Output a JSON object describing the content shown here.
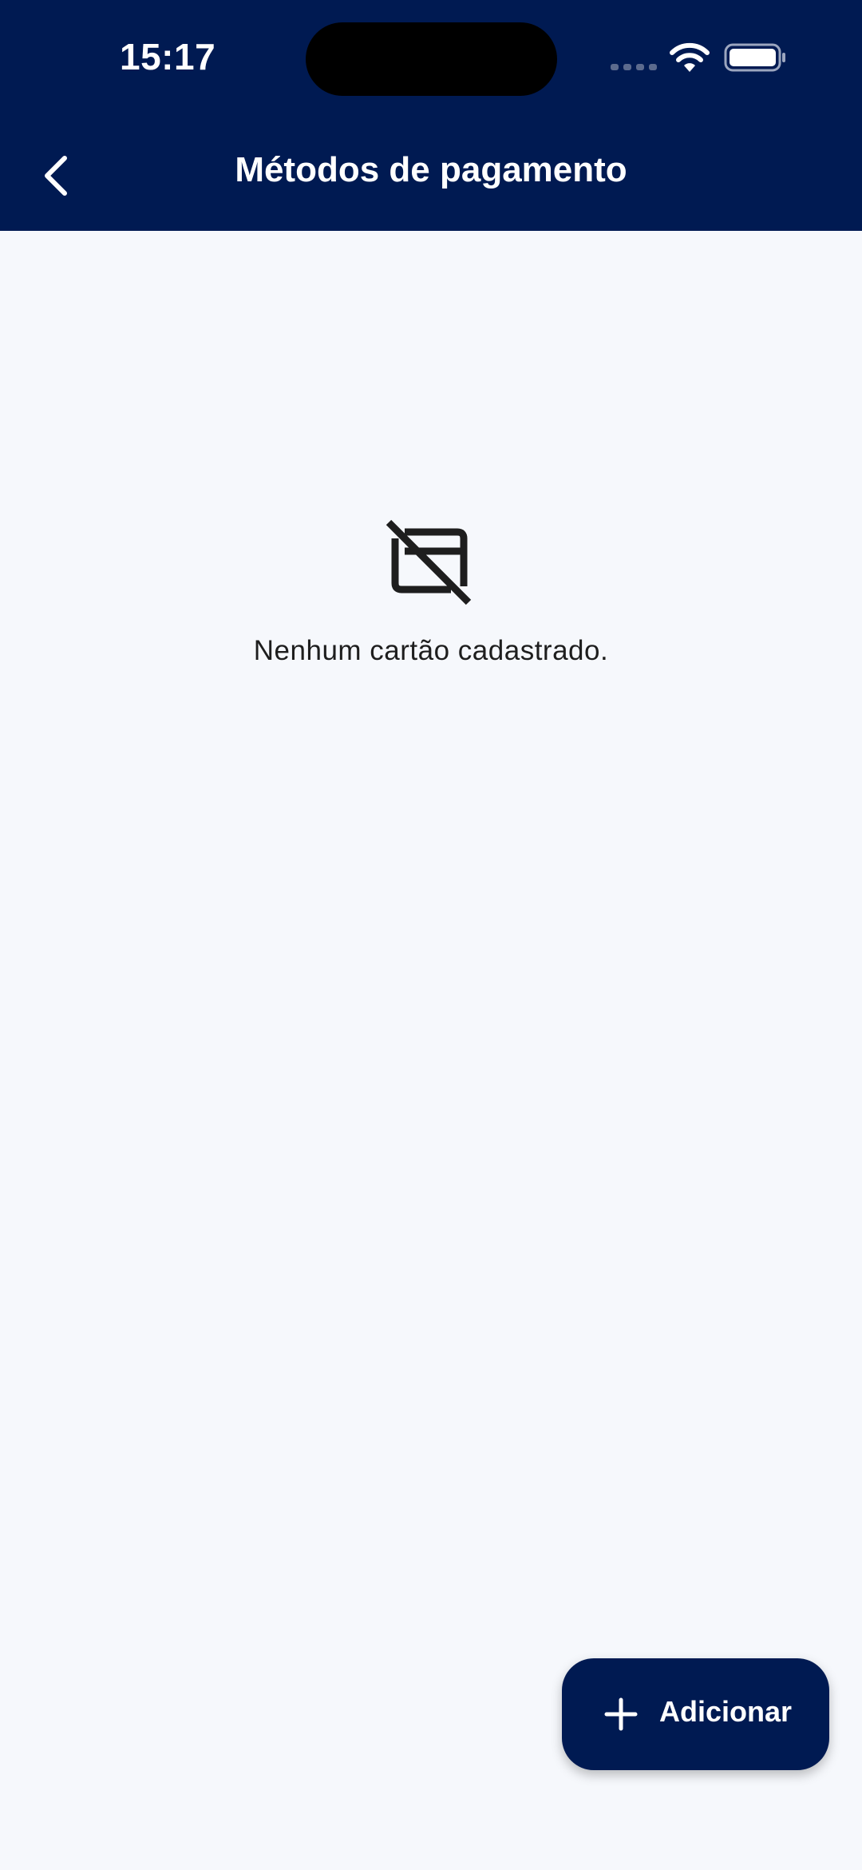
{
  "status_bar": {
    "time": "15:17"
  },
  "header": {
    "title": "Métodos de pagamento",
    "back_icon": "chevron-left-icon"
  },
  "empty_state": {
    "icon": "credit-card-off-icon",
    "message": "Nenhum cartão cadastrado."
  },
  "fab": {
    "icon": "plus-icon",
    "label": "Adicionar"
  },
  "colors": {
    "header_bg": "#001A52",
    "page_bg": "#F6F8FC",
    "text_dark": "#1E1E1E",
    "on_primary": "#FFFFFF"
  }
}
